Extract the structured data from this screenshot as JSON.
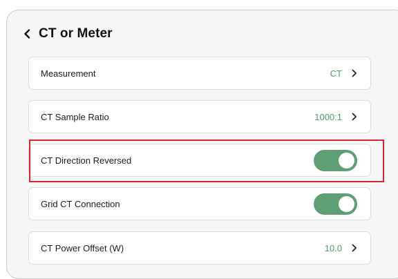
{
  "header": {
    "title": "CT or Meter",
    "back_icon": "chevron-left-icon"
  },
  "rows": [
    {
      "label": "Measurement",
      "value": "CT",
      "type": "navigate"
    },
    {
      "label": "CT Sample Ratio",
      "value": "1000:1",
      "type": "navigate"
    },
    {
      "label": "CT Direction Reversed",
      "type": "toggle",
      "toggle_on": true
    },
    {
      "label": "Grid CT Connection",
      "type": "toggle",
      "toggle_on": true
    },
    {
      "label": "CT Power Offset (W)",
      "value": "10.0",
      "type": "navigate"
    }
  ],
  "colors": {
    "accent_green": "#5f9f75",
    "value_green": "#4f9a6a",
    "highlight_red": "#d6252a",
    "panel_background": "#f6f6f6"
  }
}
